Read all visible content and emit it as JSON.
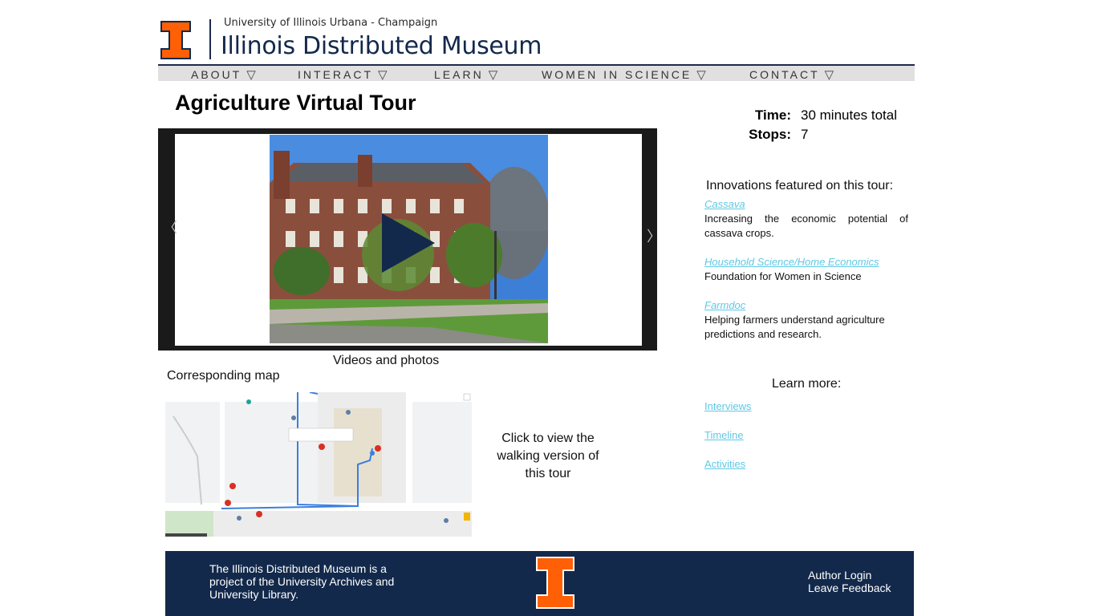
{
  "header": {
    "university": "University of Illinois Urbana - Champaign",
    "site_title": "Illinois Distributed Museum"
  },
  "nav": [
    {
      "label": "ABOUT"
    },
    {
      "label": "INTERACT"
    },
    {
      "label": "LEARN"
    },
    {
      "label": "WOMEN IN SCIENCE"
    },
    {
      "label": "CONTACT"
    }
  ],
  "page": {
    "title": "Agriculture Virtual Tour",
    "time_label": "Time:",
    "time_value": "30 minutes total",
    "stops_label": "Stops:",
    "stops_value": "7"
  },
  "media": {
    "caption": "Videos and photos",
    "map_caption": "Corresponding map",
    "walk_text": "Click to view the walking version of this tour"
  },
  "innovations": {
    "heading": "Innovations featured on this tour:",
    "items": [
      {
        "title": "Cassava",
        "desc": "Increasing the economic potential of cassava crops."
      },
      {
        "title": "Household Science/Home Economics",
        "desc": "Foundation for Women in Science"
      },
      {
        "title": "Farmdoc",
        "desc": "Helping farmers understand agriculture predictions and research."
      }
    ]
  },
  "learn_more": {
    "heading": "Learn more:",
    "links": [
      "Interviews",
      "Timeline",
      "Activities"
    ]
  },
  "footer": {
    "text": "The Illinois Distributed Museum is a project of the University Archives and University Library.",
    "author_login": "Author Login",
    "leave_feedback": "Leave Feedback"
  },
  "colors": {
    "illini_orange": "#FF5F05",
    "illini_blue": "#13294B",
    "link_cyan": "#5fc8e4"
  }
}
